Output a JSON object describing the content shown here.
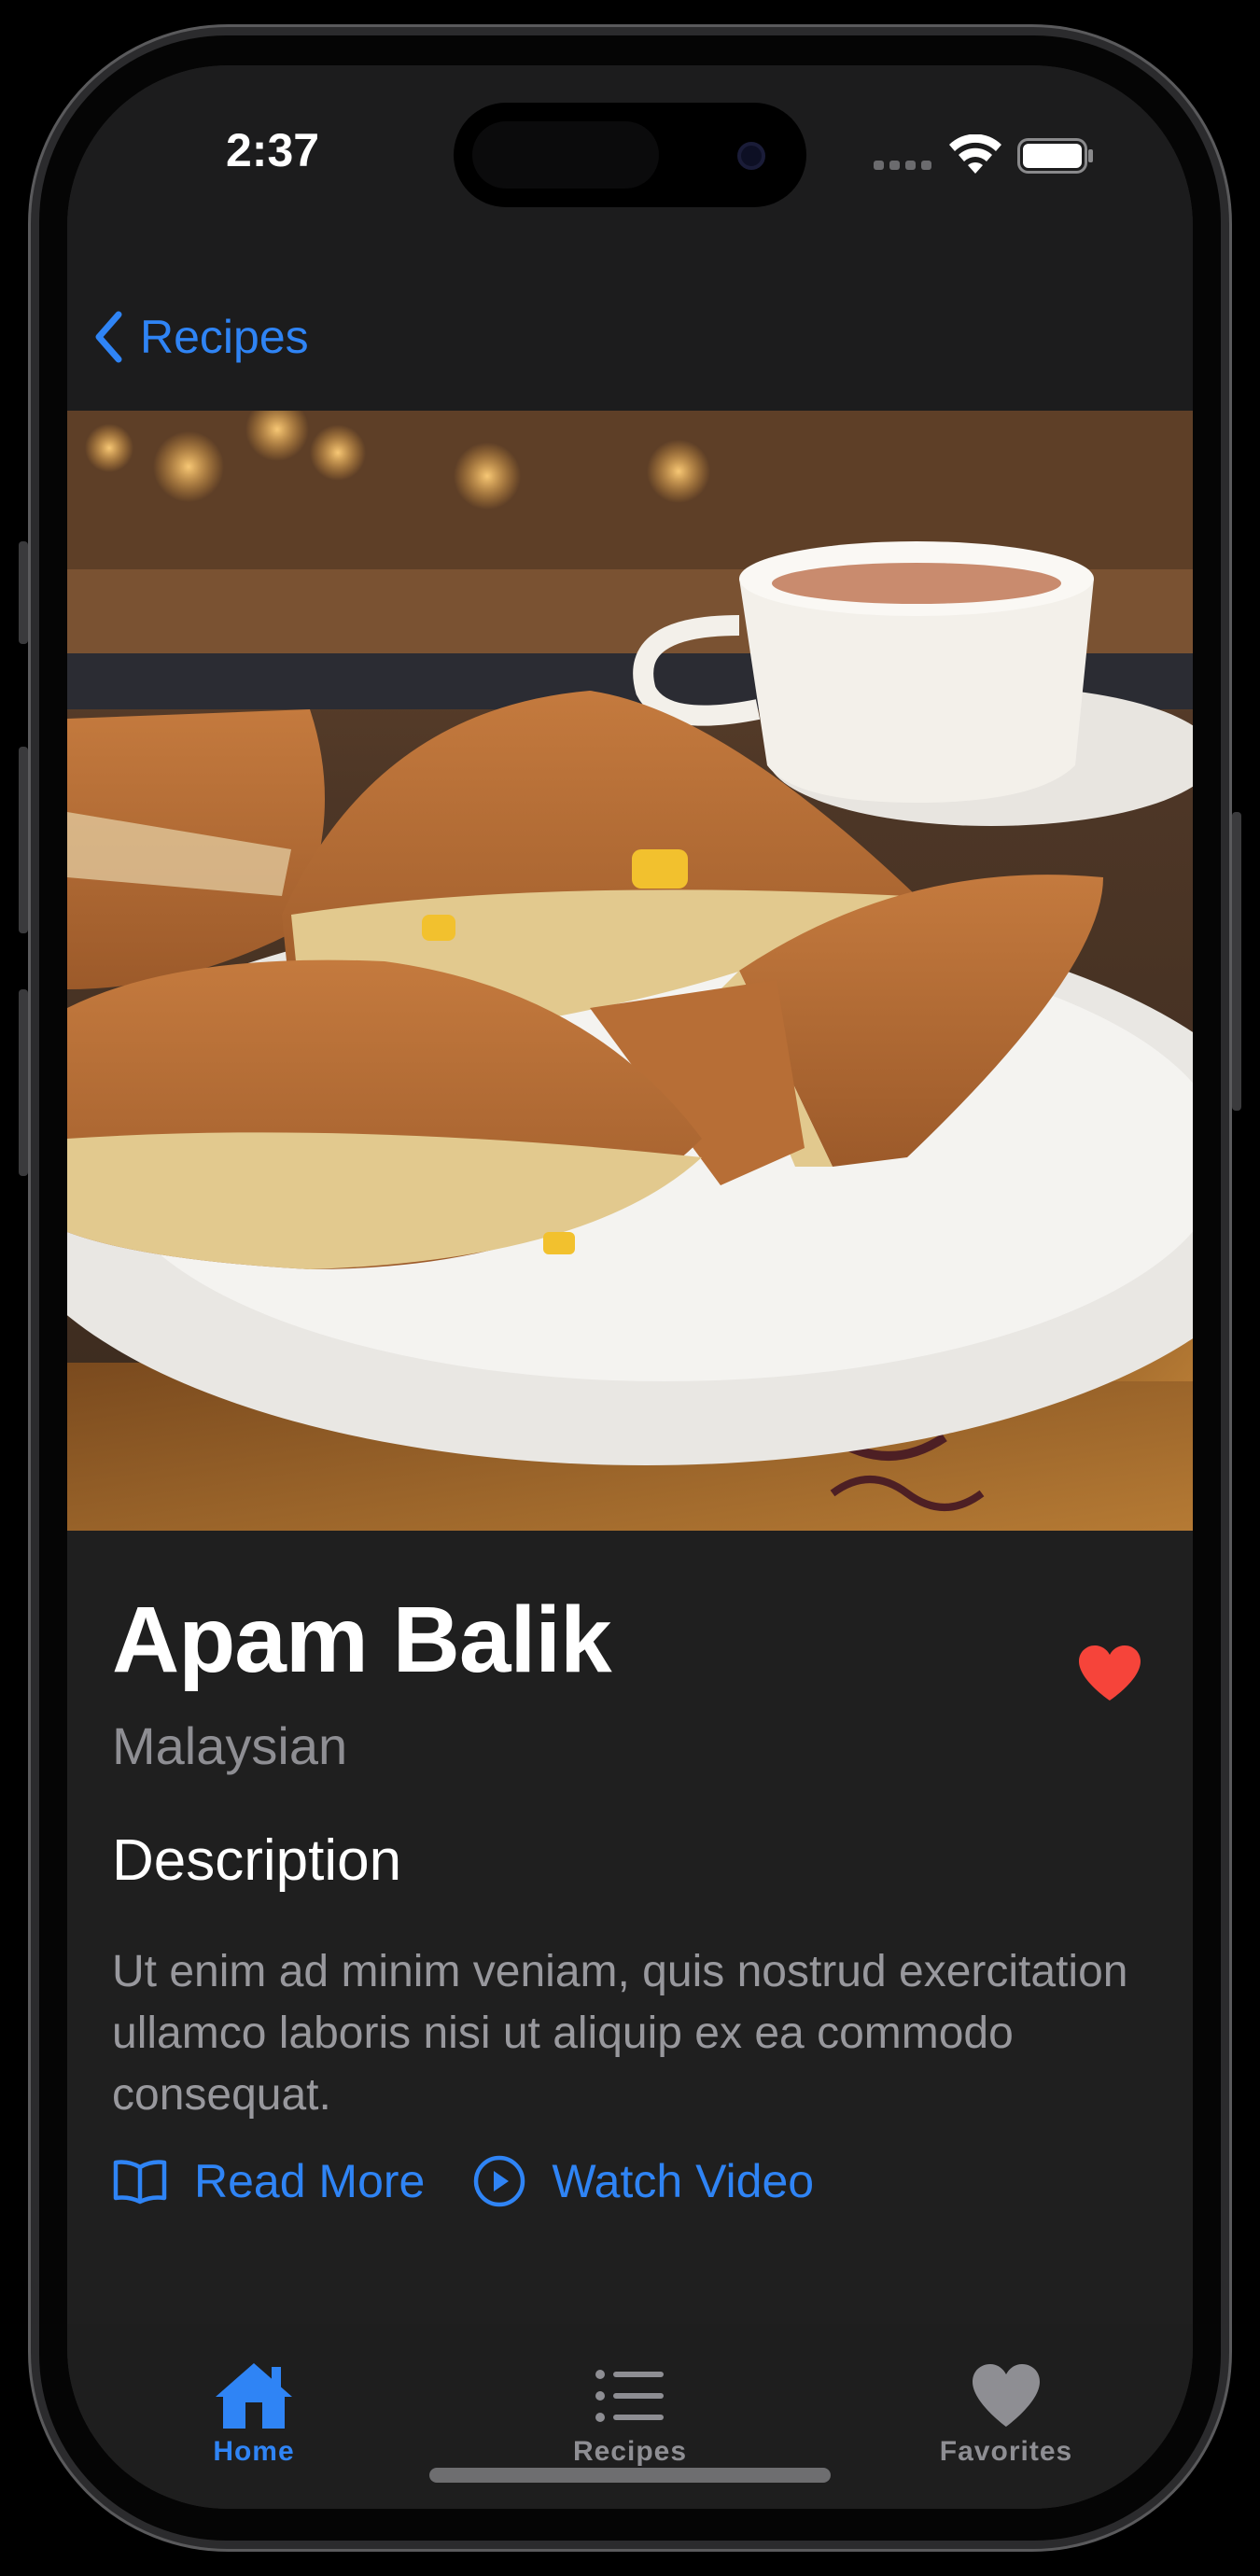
{
  "status_bar": {
    "time": "2:37"
  },
  "nav": {
    "back_label": "Recipes",
    "back_icon": "chevron-left-icon"
  },
  "hero": {
    "image_description_icon": "food-photo"
  },
  "recipe": {
    "title": "Apam Balik",
    "cuisine": "Malaysian",
    "favorite": true,
    "description_heading": "Description",
    "description": "Ut enim ad minim veniam, quis nostrud exercitation ullamco laboris nisi ut aliquip ex ea commodo consequat."
  },
  "actions": {
    "read_more_label": "Read More",
    "read_more_icon": "book-icon",
    "watch_video_label": "Watch Video",
    "watch_video_icon": "play-circle-icon"
  },
  "tabs": [
    {
      "label": "Home",
      "icon": "house-icon",
      "active": true
    },
    {
      "label": "Recipes",
      "icon": "list-icon",
      "active": false
    },
    {
      "label": "Favorites",
      "icon": "heart-icon",
      "active": false
    }
  ],
  "colors": {
    "accent": "#2f84f5",
    "favorite_heart": "#f6443a",
    "background": "#1f1f1f",
    "secondary_text": "#8e8e93"
  }
}
